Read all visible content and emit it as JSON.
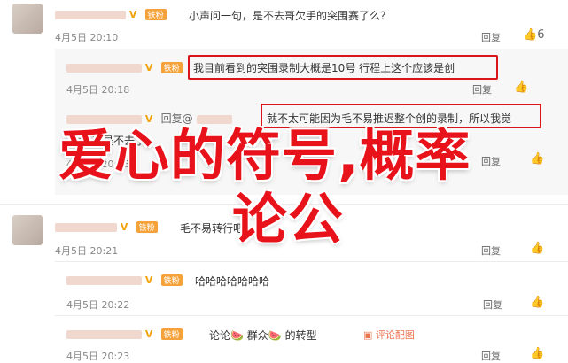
{
  "comments": [
    {
      "text": "小声问一句，是不去哥欠手的突围赛了么？",
      "badge": "铁粉",
      "date": "4月5日 20:10",
      "reply_label": "回复",
      "like_count": "6"
    },
    {
      "text": "我目前看到的突围录制大概是10号 行程上这个应该是创",
      "badge": "铁粉",
      "date": "4月5日 20:18",
      "reply_label": "回复"
    },
    {
      "reply_prefix": "回复@",
      "text": "就不太可能因为毛不易推迟整个创的录制，所以我觉",
      "date": "4月5日 20:18",
      "reply_label": "回复"
    },
    {
      "text": "大概率是不去了",
      "date": "4月5日 20:18",
      "reply_label": "回复"
    },
    {
      "text": "毛不易转行吧",
      "badge": "铁粉",
      "date": "4月5日 20:21",
      "reply_label": "回复"
    },
    {
      "text": "哈哈哈哈哈哈哈",
      "badge": "铁粉",
      "date": "4月5日 20:22",
      "reply_label": "回复"
    },
    {
      "text_parts": [
        "论论",
        "群众",
        "的转型"
      ],
      "badge": "铁粉",
      "date": "4月5日 20:23",
      "comment_link": "评论配图",
      "reply_label": "回复"
    }
  ],
  "overlay": {
    "line1": "爱心的符号,概率",
    "line2": "论公"
  },
  "colors": {
    "highlight_box": "#d9141b",
    "overlay_text": "#e8121b",
    "username": "#eb7350"
  }
}
